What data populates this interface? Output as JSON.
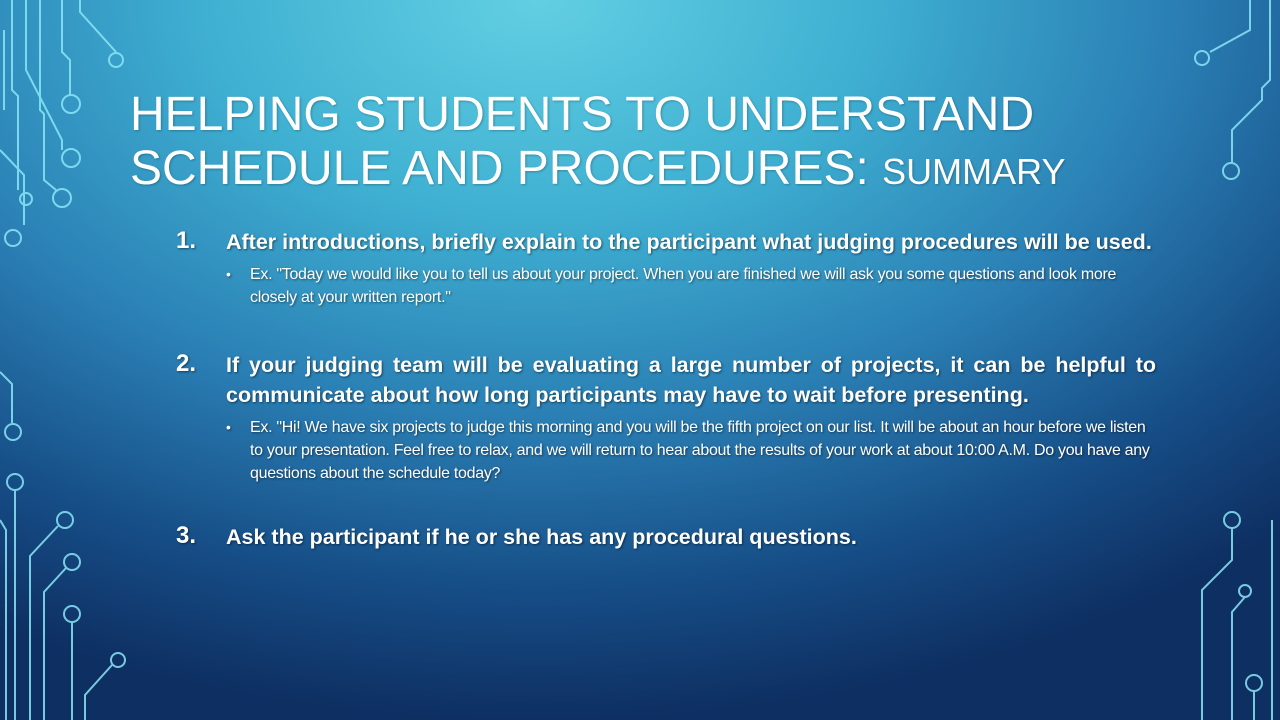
{
  "slide": {
    "title_main": "Helping Students to Understand Schedule and Procedures:",
    "title_suffix": "Summary",
    "items": [
      {
        "number": "1.",
        "text": "After introductions, briefly explain to the participant what judging procedures will be used.",
        "bullet": "•",
        "sub": "Ex. \"Today we would like you to tell us about your project. When you are finished we will ask you some questions and look more closely at your written report.\""
      },
      {
        "number": "2.",
        "text": "If your judging team will be evaluating a large number of projects, it can be helpful to communicate about how long participants may have to wait before presenting.",
        "bullet": "•",
        "sub": "Ex. \"Hi! We have six projects to judge this morning and you will be the fifth project on our list. It will be about an hour before we listen to your presentation. Feel free to relax, and we will return to hear about the results of your work at about 10:00 A.M. Do you have any questions about the schedule today?"
      },
      {
        "number": "3.",
        "text": "Ask the participant if he or she has any procedural questions."
      }
    ]
  },
  "colors": {
    "text": "#ffffff",
    "circuit": "#7fe3f5",
    "background_top": "#62cfe2",
    "background_bottom": "#0e2f62"
  }
}
